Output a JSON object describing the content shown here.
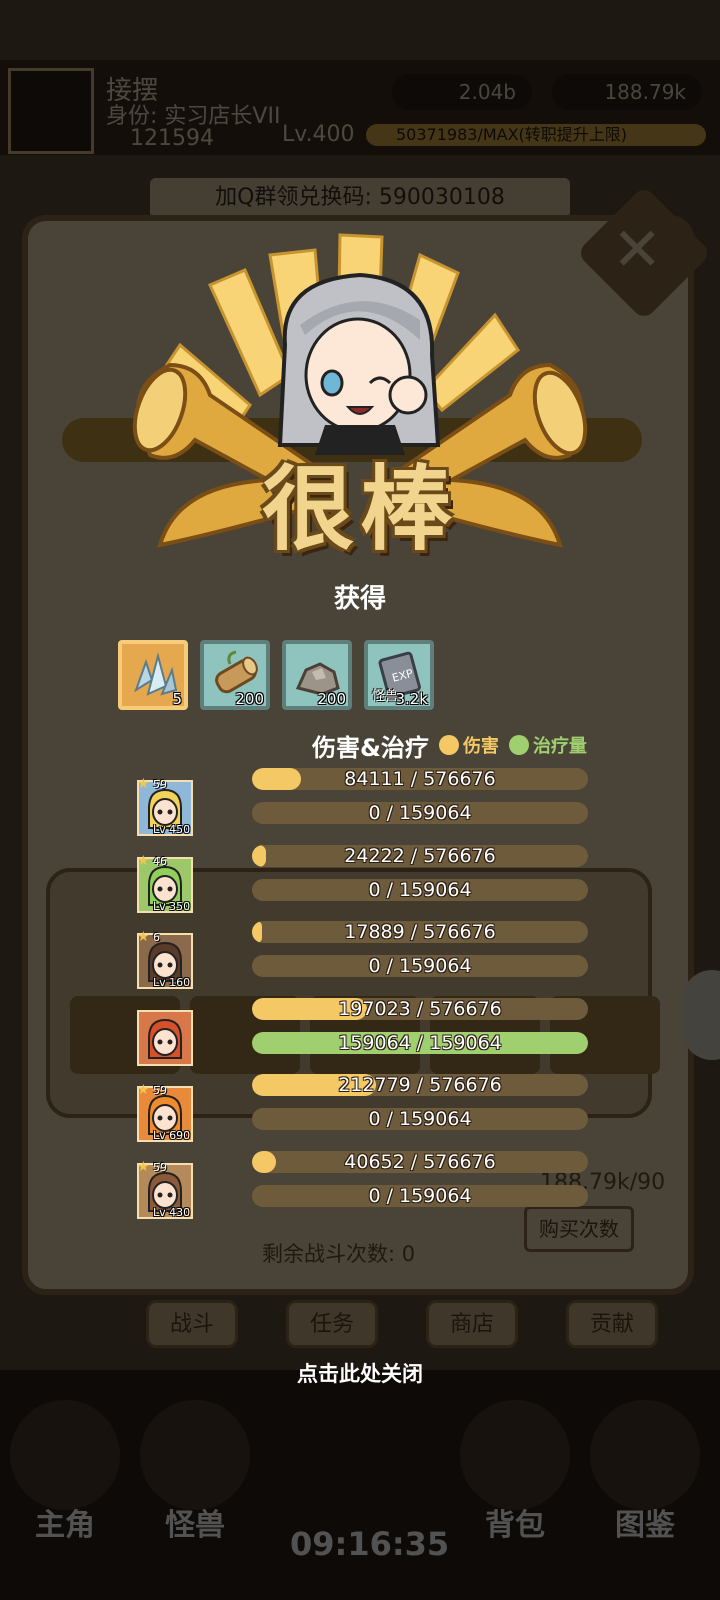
{
  "background": {
    "player_name": "接摆",
    "player_title": "身份: 实习店长VII",
    "power": "121594",
    "level": "Lv.400",
    "currency_1": "2.04b",
    "currency_2": "188.79k",
    "exp_bar": "50371983/MAX(转职提升上限)",
    "promo_code": "加Q群领兑换码: 590030108",
    "remaining_battles": "剩余战斗次数: 0",
    "buy_times": "购买次数",
    "stamina": "188.79k/90",
    "tabs": [
      "战斗",
      "任务",
      "商店",
      "贡献"
    ],
    "nav": [
      "主角",
      "怪兽",
      "背包",
      "图鉴"
    ],
    "clock": "09:16:35"
  },
  "overlay": {
    "title": "很棒",
    "obtain_label": "获得",
    "rewards": [
      {
        "icon": "crystal-icon",
        "count": "5",
        "style": "gold"
      },
      {
        "icon": "wood-log-icon",
        "count": "200",
        "style": "teal"
      },
      {
        "icon": "stone-ore-icon",
        "count": "200",
        "style": "teal"
      },
      {
        "icon": "exp-book-icon",
        "tag": "怪兽",
        "count": "3.2k",
        "style": "teal"
      }
    ],
    "legend": {
      "title": "伤害&治疗",
      "damage_label": "伤害",
      "heal_label": "治疗量",
      "damage_color": "#f4c865",
      "heal_color": "#9fcf6e"
    },
    "heroes": [
      {
        "stars": "59",
        "level": "Lv 450",
        "portrait": "blonde-mage-portrait-icon",
        "damage": 84111,
        "damage_text": "84111 / 576676",
        "damage_max": 576676,
        "heal": 0,
        "heal_text": "0 / 159064",
        "heal_max": 159064
      },
      {
        "stars": "46",
        "level": "Lv 350",
        "portrait": "green-elf-portrait-icon",
        "damage": 24222,
        "damage_text": "24222 / 576676",
        "damage_max": 576676,
        "heal": 0,
        "heal_text": "0 / 159064",
        "heal_max": 159064
      },
      {
        "stars": "6",
        "level": "Lv 160",
        "portrait": "brute-portrait-icon",
        "damage": 17889,
        "damage_text": "17889 / 576676",
        "damage_max": 576676,
        "heal": 0,
        "heal_text": "0 / 159064",
        "heal_max": 159064
      },
      {
        "stars": "",
        "level": "",
        "portrait": "redhead-healer-portrait-icon",
        "damage": 197023,
        "damage_text": "197023 / 576676",
        "damage_max": 576676,
        "heal": 159064,
        "heal_text": "159064 / 159064",
        "heal_max": 159064
      },
      {
        "stars": "59",
        "level": "Lv 690",
        "portrait": "orange-hair-girl-portrait-icon",
        "damage": 212779,
        "damage_text": "212779 / 576676",
        "damage_max": 576676,
        "heal": 0,
        "heal_text": "0 / 159064",
        "heal_max": 159064
      },
      {
        "stars": "59",
        "level": "Lv 430",
        "portrait": "bear-hood-girl-portrait-icon",
        "damage": 40652,
        "damage_text": "40652 / 576676",
        "damage_max": 576676,
        "heal": 0,
        "heal_text": "0 / 159064",
        "heal_max": 159064
      }
    ],
    "close_hint": "点击此处关闭"
  }
}
